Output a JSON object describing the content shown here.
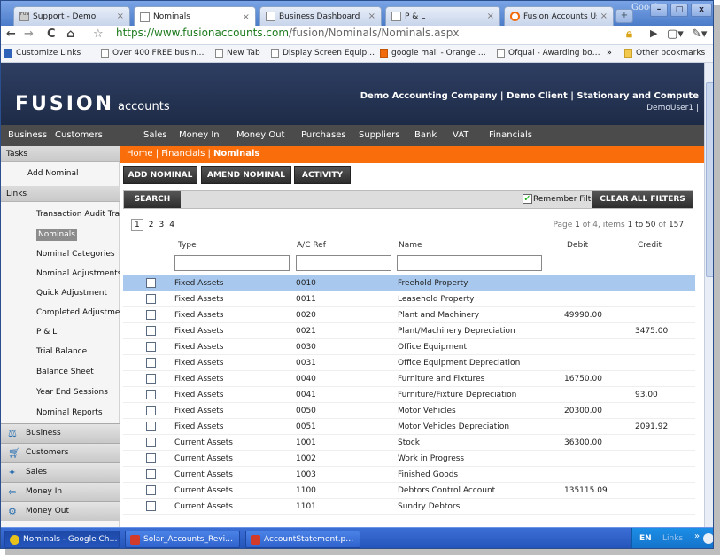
{
  "browser": {
    "brand": "Google",
    "tabs": [
      {
        "label": "Support - Demo"
      },
      {
        "label": "Nominals"
      },
      {
        "label": "Business Dashboard"
      },
      {
        "label": "P & L"
      },
      {
        "label": "Fusion Accounts Us…"
      }
    ],
    "url_base": "https://www.fusionaccounts.com",
    "url_path": "/fusion/Nominals/Nominals.aspx",
    "bookmarks": [
      "Customize Links",
      "Over 400 FREE busin…",
      "New Tab",
      "Display Screen Equip…",
      "google mail - Orange …",
      "Ofqual - Awarding bo…",
      "Other bookmarks"
    ]
  },
  "site": {
    "logo_main": "FUSION",
    "logo_sub": "accounts",
    "company_line": "Demo Accounting Company | Demo Client | Stationary and Compute",
    "user": "DemoUser1 |",
    "nav": [
      "Business",
      "Customers",
      "Sales",
      "Money In",
      "Money Out",
      "Purchases",
      "Suppliers",
      "Bank",
      "VAT",
      "Financials"
    ]
  },
  "sidebar": {
    "tasks_header": "Tasks",
    "tasks": [
      "Add Nominal"
    ],
    "links_header": "Links",
    "links": [
      "Transaction Audit Trail",
      "Nominals",
      "Nominal Categories",
      "Nominal Adjustments",
      "Quick Adjustment",
      "Completed Adjustment",
      "P & L",
      "Trial Balance",
      "Balance Sheet",
      "Year End Sessions",
      "Nominal Reports"
    ],
    "sections": [
      "Business",
      "Customers",
      "Sales",
      "Money In",
      "Money Out"
    ]
  },
  "content": {
    "breadcrumb": [
      "Home",
      "Financials",
      "Nominals"
    ],
    "actions": [
      "ADD NOMINAL",
      "AMEND NOMINAL",
      "ACTIVITY"
    ],
    "search_label": "SEARCH",
    "remember_filter": "Remember Filter",
    "clear_filters": "CLEAR ALL FILTERS",
    "pages": [
      "1",
      "2",
      "3",
      "4"
    ],
    "page_info": {
      "prefix": "Page ",
      "page": "1",
      "mid": " of 4, items ",
      "range": "1 to 50",
      "suffix": " of ",
      "total": "157",
      "end": "."
    },
    "columns": [
      "Type",
      "A/C Ref",
      "Name",
      "Debit",
      "Credit"
    ],
    "filters": [
      "",
      "",
      ""
    ],
    "rows": [
      {
        "type": "Fixed Assets",
        "ref": "0010",
        "name": "Freehold Property",
        "debit": "",
        "credit": ""
      },
      {
        "type": "Fixed Assets",
        "ref": "0011",
        "name": "Leasehold Property",
        "debit": "",
        "credit": ""
      },
      {
        "type": "Fixed Assets",
        "ref": "0020",
        "name": "Plant and Machinery",
        "debit": "49990.00",
        "credit": ""
      },
      {
        "type": "Fixed Assets",
        "ref": "0021",
        "name": "Plant/Machinery Depreciation",
        "debit": "",
        "credit": "3475.00"
      },
      {
        "type": "Fixed Assets",
        "ref": "0030",
        "name": "Office Equipment",
        "debit": "",
        "credit": ""
      },
      {
        "type": "Fixed Assets",
        "ref": "0031",
        "name": "Office Equipment Depreciation",
        "debit": "",
        "credit": ""
      },
      {
        "type": "Fixed Assets",
        "ref": "0040",
        "name": "Furniture and Fixtures",
        "debit": "16750.00",
        "credit": ""
      },
      {
        "type": "Fixed Assets",
        "ref": "0041",
        "name": "Furniture/Fixture Depreciation",
        "debit": "",
        "credit": "93.00"
      },
      {
        "type": "Fixed Assets",
        "ref": "0050",
        "name": "Motor Vehicles",
        "debit": "20300.00",
        "credit": ""
      },
      {
        "type": "Fixed Assets",
        "ref": "0051",
        "name": "Motor Vehicles Depreciation",
        "debit": "",
        "credit": "2091.92"
      },
      {
        "type": "Current Assets",
        "ref": "1001",
        "name": "Stock",
        "debit": "36300.00",
        "credit": ""
      },
      {
        "type": "Current Assets",
        "ref": "1002",
        "name": "Work in Progress",
        "debit": "",
        "credit": ""
      },
      {
        "type": "Current Assets",
        "ref": "1003",
        "name": "Finished Goods",
        "debit": "",
        "credit": ""
      },
      {
        "type": "Current Assets",
        "ref": "1100",
        "name": "Debtors Control Account",
        "debit": "135115.09",
        "credit": ""
      },
      {
        "type": "Current Assets",
        "ref": "1101",
        "name": "Sundry Debtors",
        "debit": "",
        "credit": ""
      }
    ]
  },
  "taskbar": {
    "items": [
      "Nominals - Google Ch…",
      "Solar_Accounts_Revi…",
      "AccountStatement.p…"
    ],
    "lang": "EN",
    "links": "Links"
  },
  "colors": {
    "header_bg": "#2e3f63",
    "nav_bg": "#4b4b4b",
    "breadcrumb_orange": "#f96e0b",
    "row_selected": "#a8c8ee",
    "taskbar_blue": "#2352b8"
  }
}
